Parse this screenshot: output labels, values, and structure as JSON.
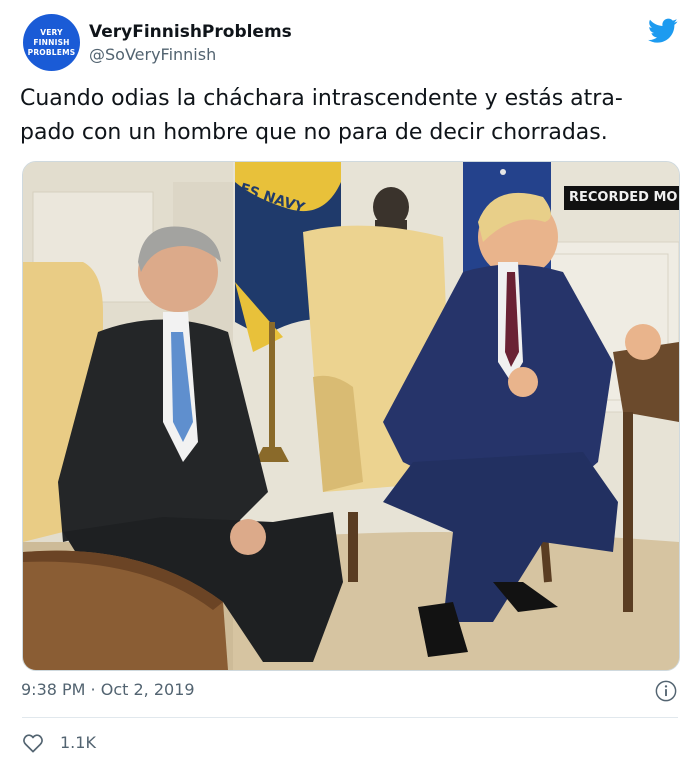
{
  "author": {
    "display_name": "VeryFinnishProblems",
    "handle": "@SoVeryFinnish",
    "avatar_lines": [
      "VERY",
      "FINNISH",
      "PROBLEMS"
    ],
    "avatar_color": "#1a5bd6"
  },
  "tweet": {
    "text_lines": [
      "Cuando odias la cháchara intrascendente y estás atra-",
      "pado con un hombre que no para de decir chorradas."
    ]
  },
  "media": {
    "overlay_label": "RECORDED MO",
    "flag_text": "ES NAVY"
  },
  "meta": {
    "timestamp": "9:38 PM · Oct 2, 2019",
    "like_count": "1.1K"
  },
  "icons": {
    "brand": "twitter-bird-icon",
    "info": "info-icon",
    "like": "heart-icon"
  },
  "colors": {
    "twitter_blue": "#1d9bf0",
    "secondary_text": "#536471"
  }
}
